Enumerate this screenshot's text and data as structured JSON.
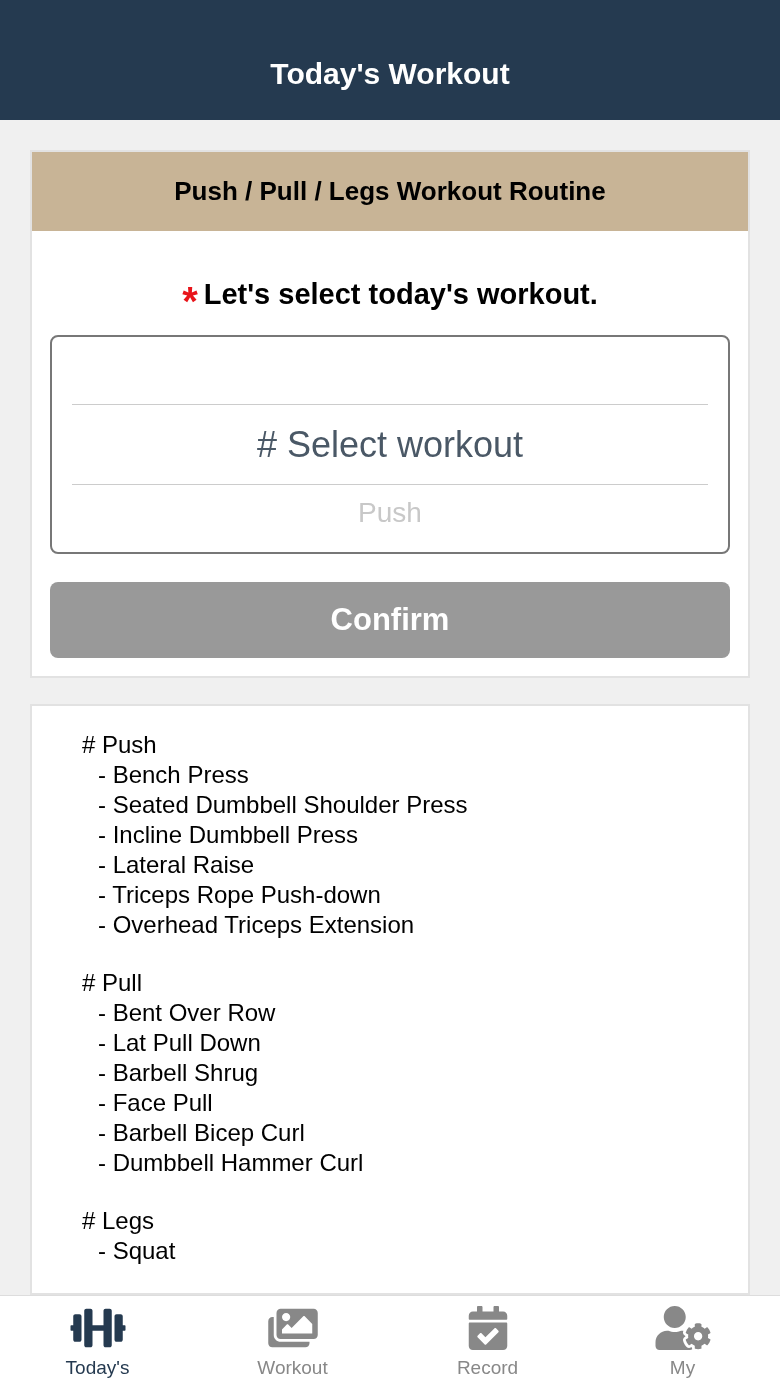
{
  "header": {
    "title": "Today's Workout"
  },
  "routine_card": {
    "title": "Push / Pull / Legs Workout Routine",
    "required_mark": "*",
    "prompt": "Let's select today's workout.",
    "picker": {
      "options": [
        {
          "label": "# Select workout",
          "selected": true
        },
        {
          "label": "Push",
          "selected": false
        }
      ]
    },
    "confirm_button": {
      "label": "Confirm",
      "disabled": true
    }
  },
  "routine_list": [
    {
      "title": "# Push",
      "items": [
        "- Bench Press",
        "- Seated Dumbbell Shoulder Press",
        "- Incline Dumbbell Press",
        "- Lateral Raise",
        "- Triceps Rope Push-down",
        "- Overhead Triceps Extension"
      ]
    },
    {
      "title": "# Pull",
      "items": [
        "- Bent Over Row",
        "- Lat Pull Down",
        "- Barbell Shrug",
        "- Face Pull",
        "- Barbell Bicep Curl",
        "- Dumbbell Hammer Curl"
      ]
    },
    {
      "title": "# Legs",
      "items": [
        "- Squat"
      ]
    }
  ],
  "tab_bar": [
    {
      "kind": "dumbbell",
      "label": "Today's",
      "selected": true
    },
    {
      "kind": "images",
      "label": "Workout",
      "selected": false
    },
    {
      "kind": "calendar",
      "label": "Record",
      "selected": false
    },
    {
      "kind": "user",
      "label": "My",
      "selected": false
    }
  ]
}
